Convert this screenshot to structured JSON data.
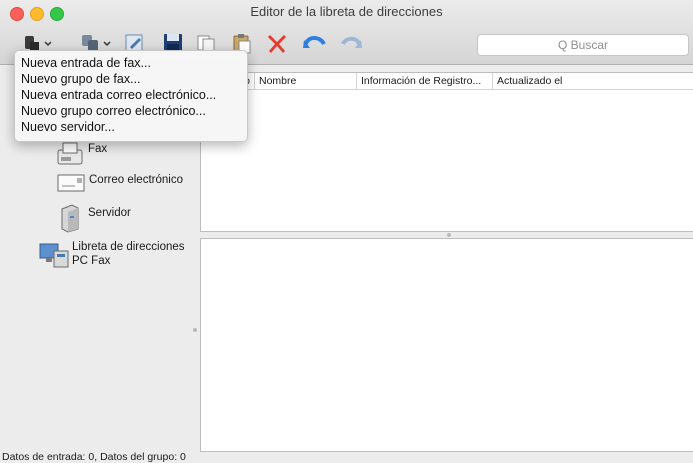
{
  "window": {
    "title": "Editor de la libreta de direcciones"
  },
  "toolbar": {
    "search_placeholder": "Q Buscar",
    "icons": [
      "new-entry-icon",
      "new-group-icon",
      "edit-icon",
      "save-icon",
      "copy-icon",
      "paste-icon",
      "delete-icon",
      "undo-icon",
      "redo-icon"
    ]
  },
  "menu": {
    "items": [
      "Nueva entrada de fax...",
      "Nuevo grupo de fax...",
      "Nueva entrada correo electrónico...",
      "Nuevo grupo correo electrónico...",
      "Nuevo servidor..."
    ]
  },
  "sidebar": {
    "items": [
      {
        "label": "Fax",
        "icon": "fax-icon"
      },
      {
        "label": "Correo electrónico",
        "icon": "email-icon"
      },
      {
        "label": "Servidor",
        "icon": "server-icon"
      },
      {
        "label": "Libreta de direcciones\nPC Fax",
        "icon": "pc-fax-icon"
      }
    ]
  },
  "table": {
    "columns": [
      "o",
      "Nombre",
      "Información de Registro...",
      "Actualizado el"
    ]
  },
  "status": {
    "text": "Datos de entrada: 0, Datos del grupo: 0"
  },
  "colors": {
    "delete": "#e53b2c",
    "undo": "#2f7fe0",
    "accent": "#3b7bdc"
  }
}
